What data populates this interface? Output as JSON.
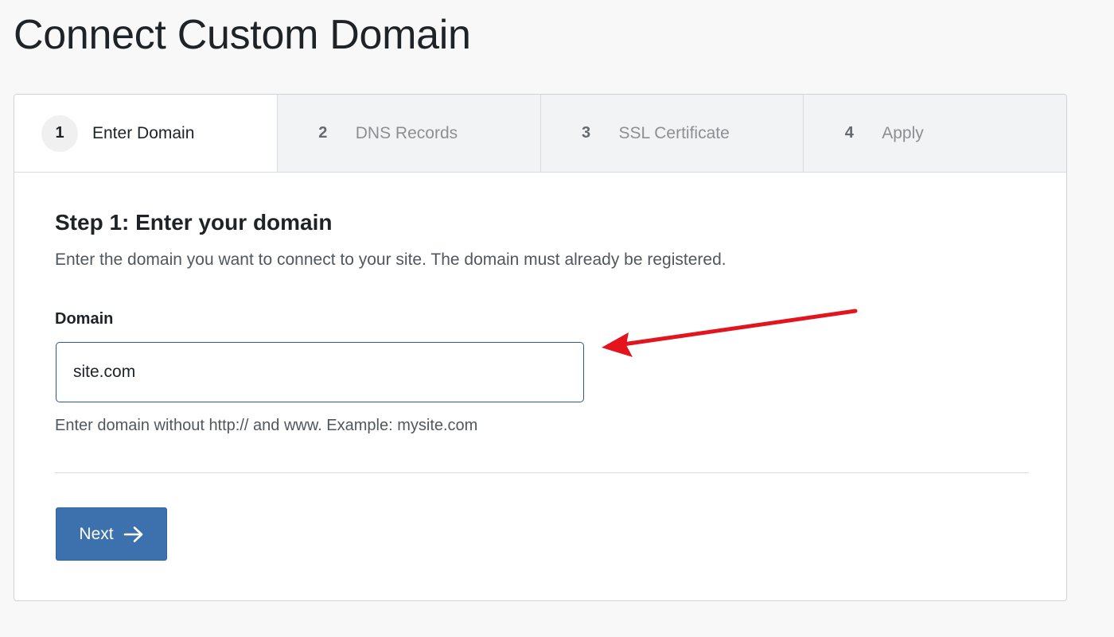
{
  "page": {
    "title": "Connect Custom Domain"
  },
  "wizard": {
    "steps": [
      {
        "number": "1",
        "label": "Enter Domain",
        "active": true
      },
      {
        "number": "2",
        "label": "DNS Records",
        "active": false
      },
      {
        "number": "3",
        "label": "SSL Certificate",
        "active": false
      },
      {
        "number": "4",
        "label": "Apply",
        "active": false
      }
    ]
  },
  "form": {
    "heading": "Step 1: Enter your domain",
    "description": "Enter the domain you want to connect to your site. The domain must already be registered.",
    "domain_label": "Domain",
    "domain_value": "site.com",
    "domain_help": "Enter domain without http:// and www. Example: mysite.com",
    "next_label": "Next"
  },
  "icons": {
    "next_button_icon": "arrow-right-icon",
    "annotation": "red-pointer-arrow-icon"
  },
  "colors": {
    "primary_button": "#3c71ae",
    "input_border_focus": "#2c5a86",
    "annotation_arrow": "#e3141e"
  }
}
